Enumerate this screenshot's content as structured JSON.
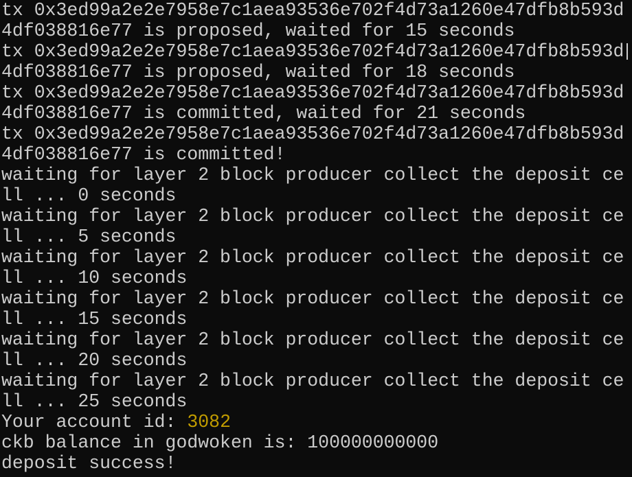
{
  "terminal": {
    "lines": [
      "tx 0x3ed99a2e2e7958e7c1aea93536e702f4d73a1260e47dfb8b593d",
      "4df038816e77 is proposed, waited for 15 seconds",
      "tx 0x3ed99a2e2e7958e7c1aea93536e702f4d73a1260e47dfb8b593d",
      "4df038816e77 is proposed, waited for 18 seconds",
      "tx 0x3ed99a2e2e7958e7c1aea93536e702f4d73a1260e47dfb8b593d",
      "4df038816e77 is committed, waited for 21 seconds",
      "tx 0x3ed99a2e2e7958e7c1aea93536e702f4d73a1260e47dfb8b593d",
      "4df038816e77 is committed!",
      "waiting for layer 2 block producer collect the deposit ce",
      "ll ... 0 seconds",
      "waiting for layer 2 block producer collect the deposit ce",
      "ll ... 5 seconds",
      "waiting for layer 2 block producer collect the deposit ce",
      "ll ... 10 seconds",
      "waiting for layer 2 block producer collect the deposit ce",
      "ll ... 15 seconds",
      "waiting for layer 2 block producer collect the deposit ce",
      "ll ... 20 seconds",
      "waiting for layer 2 block producer collect the deposit ce",
      "ll ... 25 seconds"
    ],
    "account_label": "Your account id: ",
    "account_id": "3082",
    "balance_line": "ckb balance in godwoken is: 100000000000",
    "success_line": "deposit success!",
    "colors": {
      "background": "#0c0c0c",
      "text": "#cccccc",
      "highlight": "#c19c00"
    }
  }
}
